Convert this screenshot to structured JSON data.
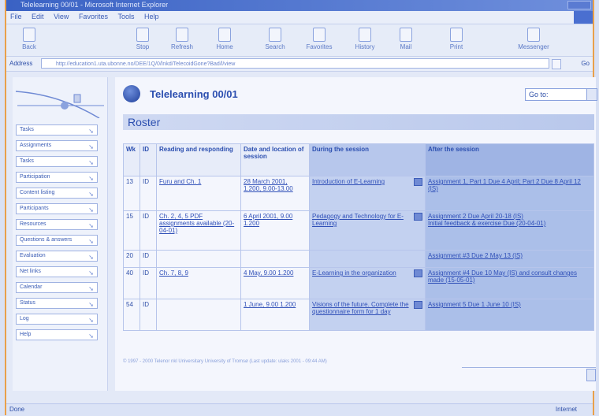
{
  "window": {
    "title": "Telelearning 00/01 - Microsoft Internet Explorer"
  },
  "menu": [
    "File",
    "Edit",
    "View",
    "Favorites",
    "Tools",
    "Help"
  ],
  "toolbar": [
    {
      "label": "Back",
      "icon": "back-arrow-icon"
    },
    {
      "label": "Stop",
      "icon": "stop-icon"
    },
    {
      "label": "Refresh",
      "icon": "refresh-icon"
    },
    {
      "label": "Home",
      "icon": "home-icon"
    },
    {
      "label": "Search",
      "icon": "search-icon"
    },
    {
      "label": "Favorites",
      "icon": "favorites-icon"
    },
    {
      "label": "History",
      "icon": "history-icon"
    },
    {
      "label": "Mail",
      "icon": "mail-icon"
    },
    {
      "label": "Print",
      "icon": "print-icon"
    },
    {
      "label": "Messenger",
      "icon": "messenger-icon"
    }
  ],
  "address": {
    "label": "Address",
    "url": "http://education1.uta.ubonne.no/DEE/1Q/0/lnkd/TelecoidGone?Bad/l/view",
    "go": "Go"
  },
  "sidebar": {
    "items": [
      "Tasks",
      "Assignments",
      "Tasks",
      "Participation",
      "Content listing",
      "Participants",
      "Resources",
      "Questions & answers",
      "Evaluation",
      "Net links",
      "Calendar",
      "Status",
      "Log",
      "Help"
    ]
  },
  "main": {
    "course_title": "Telelearning 00/01",
    "goto": "Go to:",
    "section": "Roster",
    "columns": [
      "Wk",
      "ID",
      "Reading and responding",
      "Date and location of session",
      "During the session",
      "After the session"
    ],
    "rows": [
      {
        "wk": "13",
        "id": "ID",
        "reading": "Furu and Ch. 1",
        "date": "28 March 2001, 1.200, 9.00-13.00",
        "during": "Introduction of E-Learning",
        "after": "Assignment 1, Part 1 Due 4 April; Part 2 Due 8 April 12 (IS)"
      },
      {
        "wk": "15",
        "id": "ID",
        "reading": "Ch. 2, 4, 5 PDF assignments available (20-04-01)",
        "date": "6 April 2001, 9.00 1.200",
        "during": "Pedagogy and Technology for E-Learning",
        "after": "Assignment 2 Due April 20-18 (IS)|Initial feedback & exercise Due (20-04-01)"
      },
      {
        "wk": "20",
        "id": "ID",
        "reading": "",
        "date": "",
        "during": "",
        "after": "Assignment #3 Due 2 May 13 (IS)"
      },
      {
        "wk": "40",
        "id": "ID",
        "reading": "Ch. 7, 8, 9",
        "date": "4 May, 9.00 1.200",
        "during": "E-Learning in the organization",
        "after": "Assignment #4 Due 10 May (IS) and consult changes made (15-05-01)"
      },
      {
        "wk": "54",
        "id": "ID",
        "reading": "",
        "date": "1 June, 9.00 1.200",
        "during": "Visions of the future. Complete the questionnaire form for 1 day",
        "after": "Assignment 5 Due 1 June 10 (IS)"
      }
    ],
    "footer": "© 1997 - 2000 Telenor nkl Universitary University of Tromsø (Last update: ulaks 2001 - 09:44 AM)"
  },
  "status": {
    "left": "Done",
    "right": "Internet"
  }
}
